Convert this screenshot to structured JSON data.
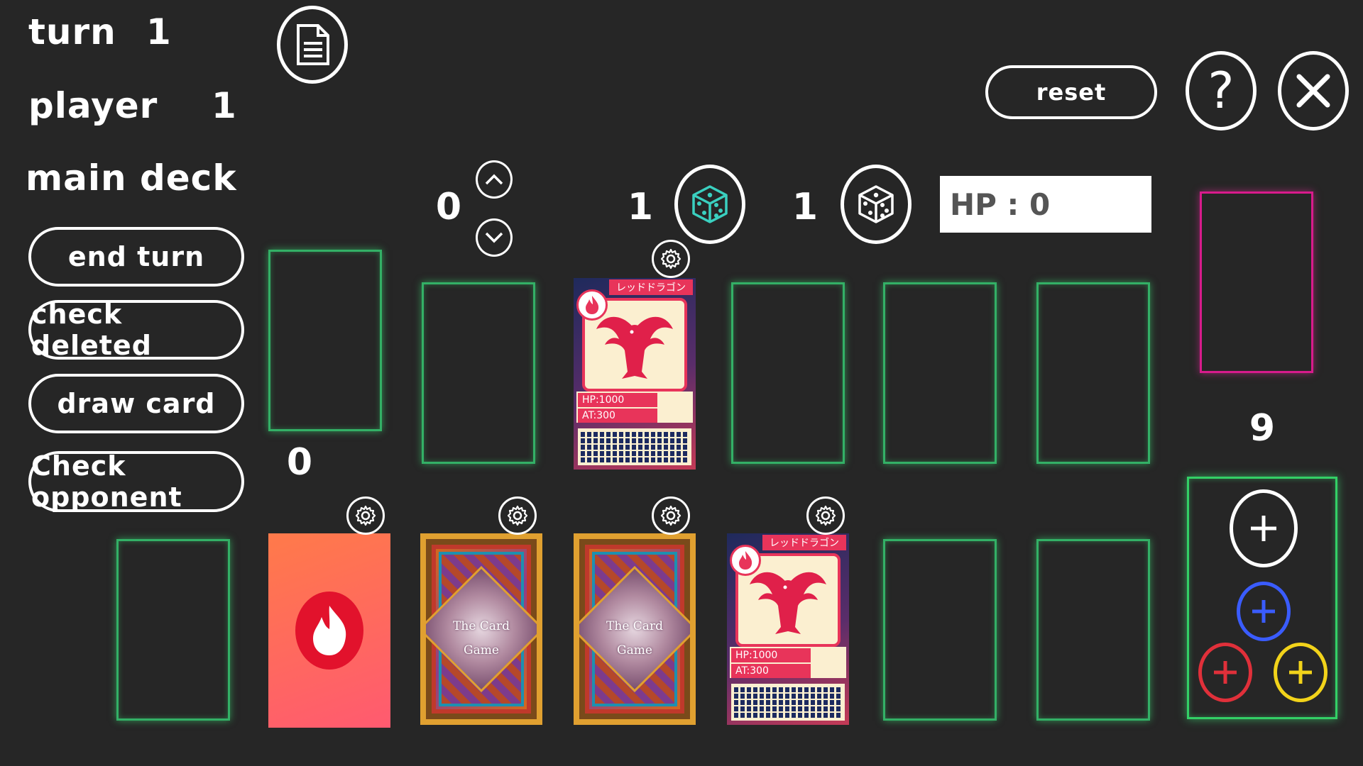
{
  "header": {
    "turn_label": "turn",
    "turn_value": "1",
    "player_label": "player",
    "player_value": "1",
    "deck_label": "main deck"
  },
  "actions": {
    "end_turn": "end turn",
    "check_deleted": "check deleted",
    "draw_card": "draw card",
    "check_opponent": "Check opponent",
    "reset": "reset"
  },
  "counters": {
    "upper_counter": "0",
    "left_count": "0",
    "die1_value": "1",
    "die2_value": "1",
    "right_count": "9"
  },
  "hp": {
    "text": "HP : 0"
  },
  "cards": {
    "dragon_name": "レッドドラゴン",
    "dragon_hp": "HP:1000",
    "dragon_at": "AT:300",
    "back_line1": "The Card",
    "back_line2": "Game"
  },
  "colors": {
    "slot_border": "#33b066",
    "discard_border": "#d81b8c",
    "active_die": "#3ad0c0",
    "token_white": "#ffffff",
    "token_blue": "#3a5cff",
    "token_red": "#e0303a",
    "token_yellow": "#f2d31a"
  }
}
